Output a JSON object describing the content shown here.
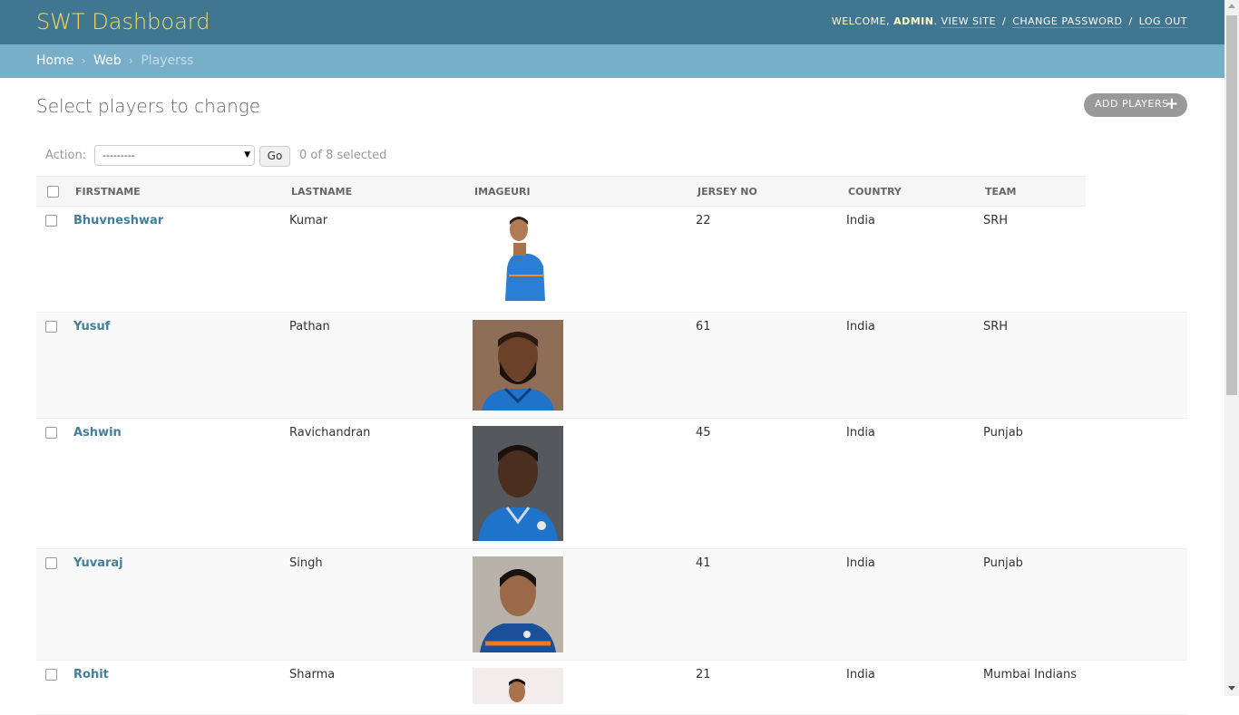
{
  "header": {
    "brand": "SWT Dashboard",
    "welcome": "Welcome,",
    "username": "admin",
    "view_site": "View site",
    "change_password": "Change password",
    "logout": "Log out",
    "sep": "/",
    "dot": "."
  },
  "breadcrumbs": {
    "home": "Home",
    "app": "Web",
    "current": "Playerss",
    "sep": "›"
  },
  "page": {
    "title": "Select players to change",
    "add_button": "Add players",
    "add_icon": "+"
  },
  "actions": {
    "label": "Action:",
    "selected_option": "---------",
    "go": "Go",
    "counter": "0 of 8 selected"
  },
  "table": {
    "headers": [
      "Firstname",
      "Lastname",
      "Imageuri",
      "Jersey no",
      "Country",
      "Team"
    ],
    "rows": [
      {
        "firstname": "Bhuvneshwar",
        "lastname": "Kumar",
        "jersey": "22",
        "country": "India",
        "team": "SRH",
        "image": "player-photo-cutout"
      },
      {
        "firstname": "Yusuf",
        "lastname": "Pathan",
        "jersey": "61",
        "country": "India",
        "team": "SRH",
        "image": "player-photo"
      },
      {
        "firstname": "Ashwin",
        "lastname": "Ravichandran",
        "jersey": "45",
        "country": "India",
        "team": "Punjab",
        "image": "player-photo"
      },
      {
        "firstname": "Yuvaraj",
        "lastname": "Singh",
        "jersey": "41",
        "country": "India",
        "team": "Punjab",
        "image": "player-photo"
      },
      {
        "firstname": "Rohit",
        "lastname": "Sharma",
        "jersey": "21",
        "country": "India",
        "team": "Mumbai Indians",
        "image": "player-photo"
      }
    ]
  },
  "colors": {
    "header_bg": "#417690",
    "brand": "#f5dd5d",
    "breadcrumb_bg": "#79aec8",
    "link": "#447e9b",
    "jersey_blue": "#1f73c9"
  }
}
